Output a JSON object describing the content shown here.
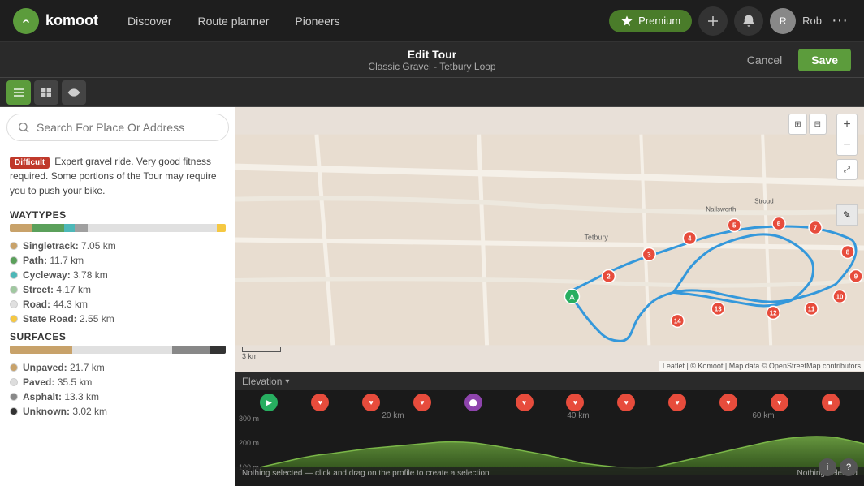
{
  "nav": {
    "logo_text": "komoot",
    "links": [
      "Discover",
      "Route planner",
      "Pioneers"
    ],
    "premium_label": "Premium",
    "user_name": "Rob",
    "more_label": "···"
  },
  "edit_header": {
    "title": "Edit Tour",
    "subtitle": "Classic Gravel - Tetbury Loop",
    "cancel_label": "Cancel",
    "save_label": "Save"
  },
  "search": {
    "placeholder": "Search For Place Or Address"
  },
  "difficulty": {
    "badge": "Difficult",
    "description": "Expert gravel ride. Very good fitness required. Some portions of the Tour may require you to push your bike."
  },
  "waytypes": {
    "title": "WAYTYPES",
    "bar": [
      {
        "color": "#c8a26a",
        "pct": 10
      },
      {
        "color": "#5ba05b",
        "pct": 15
      },
      {
        "color": "#4db8b8",
        "pct": 5
      },
      {
        "color": "#a0a0a0",
        "pct": 6
      },
      {
        "color": "#e0e0e0",
        "pct": 60
      },
      {
        "color": "#f5c842",
        "pct": 4
      }
    ],
    "items": [
      {
        "color": "#c8a26a",
        "label": "Singletrack:",
        "value": "7.05 km"
      },
      {
        "color": "#5ba05b",
        "label": "Path:",
        "value": "11.7 km"
      },
      {
        "color": "#4db8b8",
        "label": "Cycleway:",
        "value": "3.78 km"
      },
      {
        "color": "#a0c8a0",
        "label": "Street:",
        "value": "4.17 km"
      },
      {
        "color": "#e0e0e0",
        "label": "Road:",
        "value": "44.3 km"
      },
      {
        "color": "#f5c842",
        "label": "State Road:",
        "value": "2.55 km"
      }
    ]
  },
  "surfaces": {
    "title": "SURFACES",
    "bar": [
      {
        "color": "#c8a26a",
        "pct": 29
      },
      {
        "color": "#e0e0e0",
        "pct": 46
      },
      {
        "color": "#888",
        "pct": 18
      },
      {
        "color": "#333",
        "pct": 7
      }
    ],
    "items": [
      {
        "color": "#c8a26a",
        "label": "Unpaved:",
        "value": "21.7 km"
      },
      {
        "color": "#ddd",
        "label": "Paved:",
        "value": "35.5 km"
      },
      {
        "color": "#888",
        "label": "Asphalt:",
        "value": "13.3 km"
      },
      {
        "color": "#333",
        "label": "Unknown:",
        "value": "3.02 km"
      }
    ]
  },
  "elevation": {
    "label": "Elevation",
    "status_left": "Nothing selected — click and drag on the profile to create a selection",
    "status_right": "Nothing selected",
    "km_labels": [
      "20 km",
      "40 km",
      "60 km"
    ],
    "y_labels": [
      "300 m",
      "200 m",
      "100 m"
    ],
    "waypoints": [
      "▶",
      "♥",
      "♥",
      "♥",
      "♥",
      "⬤",
      "♥",
      "♥",
      "♥",
      "♥",
      "♥",
      "♥"
    ]
  },
  "map": {
    "zoom_in": "+",
    "zoom_out": "−",
    "scale_label": "3 km",
    "attribution": "Leaflet | © Komoot | Map data © OpenStreetMap contributors"
  }
}
